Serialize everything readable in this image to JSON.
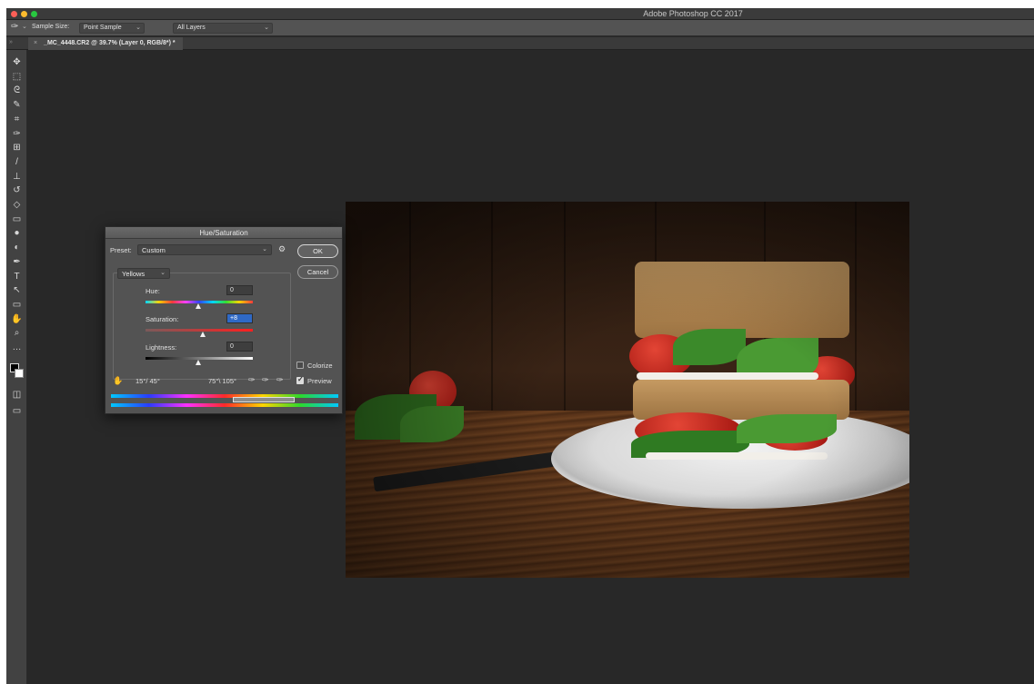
{
  "app": {
    "title": "Adobe Photoshop CC 2017"
  },
  "colors": {
    "close": "#fc5f57",
    "minimize": "#fdbc2e",
    "maximize": "#28c840",
    "accent": "#2f69c6"
  },
  "options_bar": {
    "tool_icon": "eyedropper-icon",
    "sample_size_label": "Sample Size:",
    "sample_size_value": "Point Sample",
    "sample_layers_value": "All Layers"
  },
  "document_tab": {
    "title": "_MC_4448.CR2 @ 39.7% (Layer 0, RGB/8*) *"
  },
  "toolbar": {
    "tools": [
      {
        "name": "move-tool",
        "icon": "✥"
      },
      {
        "name": "marquee-tool",
        "icon": "⬚"
      },
      {
        "name": "lasso-tool",
        "icon": "ᘓ"
      },
      {
        "name": "quick-select-tool",
        "icon": "✎"
      },
      {
        "name": "crop-tool",
        "icon": "⌗"
      },
      {
        "name": "eyedropper-tool",
        "icon": "✑"
      },
      {
        "name": "healing-tool",
        "icon": "⊞"
      },
      {
        "name": "brush-tool",
        "icon": "/"
      },
      {
        "name": "stamp-tool",
        "icon": "⊥"
      },
      {
        "name": "history-brush-tool",
        "icon": "↺"
      },
      {
        "name": "eraser-tool",
        "icon": "◇"
      },
      {
        "name": "gradient-tool",
        "icon": "▭"
      },
      {
        "name": "blur-tool",
        "icon": "●"
      },
      {
        "name": "dodge-tool",
        "icon": "◐"
      },
      {
        "name": "pen-tool",
        "icon": "✒"
      },
      {
        "name": "type-tool",
        "icon": "T"
      },
      {
        "name": "path-select-tool",
        "icon": "↖"
      },
      {
        "name": "shape-tool",
        "icon": "▭"
      },
      {
        "name": "hand-tool",
        "icon": "✋"
      },
      {
        "name": "zoom-tool",
        "icon": "⌕"
      },
      {
        "name": "more-tools",
        "icon": "…"
      }
    ]
  },
  "dialog": {
    "title": "Hue/Saturation",
    "preset_label": "Preset:",
    "preset_value": "Custom",
    "ok_label": "OK",
    "cancel_label": "Cancel",
    "channel_value": "Yellows",
    "hue_label": "Hue:",
    "hue_value": "0",
    "saturation_label": "Saturation:",
    "saturation_value": "+8",
    "lightness_label": "Lightness:",
    "lightness_value": "0",
    "colorize_label": "Colorize",
    "colorize_checked": false,
    "preview_label": "Preview",
    "preview_checked": true,
    "range_left": "15°/ 45°",
    "range_right": "75°\\ 105°"
  }
}
